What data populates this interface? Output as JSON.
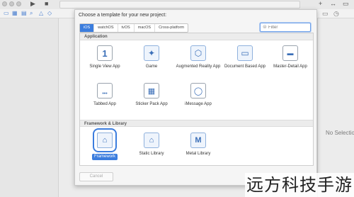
{
  "sheet": {
    "title": "Choose a template for your new project:",
    "platform_tabs": [
      "iOS",
      "watchOS",
      "tvOS",
      "macOS",
      "Cross-platform"
    ],
    "active_tab": "iOS",
    "filter_placeholder": "Filter",
    "cancel_label": "Cancel"
  },
  "sections": [
    {
      "header": "Application",
      "templates": [
        {
          "label": "Single View App",
          "icon": "single-view-icon"
        },
        {
          "label": "Game",
          "icon": "game-icon"
        },
        {
          "label": "Augmented Reality App",
          "icon": "ar-icon"
        },
        {
          "label": "Document Based App",
          "icon": "folder-icon"
        },
        {
          "label": "Master-Detail App",
          "icon": "master-detail-icon"
        },
        {
          "label": "Tabbed App",
          "icon": "tabbed-icon"
        },
        {
          "label": "Sticker Pack App",
          "icon": "sticker-pack-icon"
        },
        {
          "label": "iMessage App",
          "icon": "imessage-icon"
        }
      ]
    },
    {
      "header": "Framework & Library",
      "templates": [
        {
          "label": "Framework",
          "icon": "framework-icon",
          "selected": true
        },
        {
          "label": "Static Library",
          "icon": "static-library-icon"
        },
        {
          "label": "Metal Library",
          "icon": "metal-library-icon"
        }
      ]
    }
  ],
  "inspector": {
    "empty_text": "No Selection"
  },
  "watermark": {
    "text": "远方科技手游"
  },
  "colors": {
    "accent": "#3b7dde",
    "window_bg": "#ececec"
  }
}
